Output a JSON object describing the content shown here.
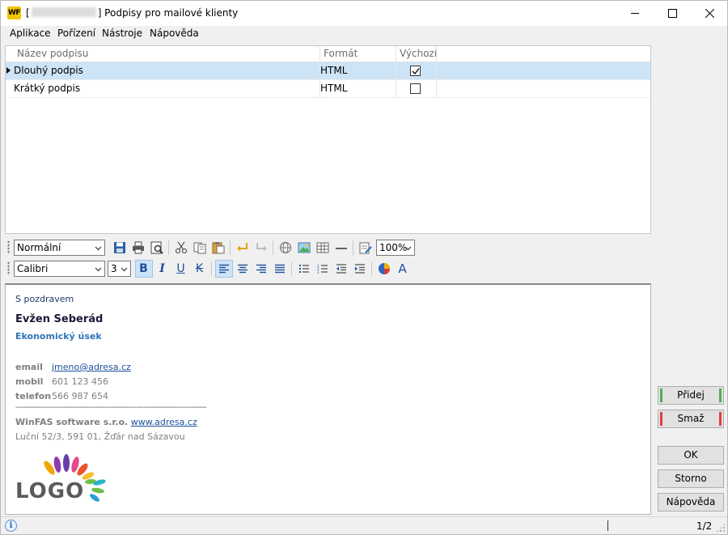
{
  "window": {
    "title_prefix": "[",
    "title_suffix": "] Podpisy pro mailové klienty",
    "minimize_label": "",
    "close_label": ""
  },
  "menu": [
    "Aplikace",
    "Pořízení",
    "Nástroje",
    "Nápověda"
  ],
  "grid": {
    "columns": [
      "Název podpisu",
      "Formát",
      "Výchozí"
    ],
    "rows": [
      {
        "name": "Dlouhý podpis",
        "format": "HTML",
        "default": true,
        "selected": true
      },
      {
        "name": "Krátký podpis",
        "format": "HTML",
        "default": false,
        "selected": false
      }
    ]
  },
  "toolbar1": {
    "style_value": "Normální",
    "zoom_value": "100%",
    "icons": [
      "save-icon",
      "print-icon",
      "print-preview-icon",
      "cut-icon",
      "copy-icon",
      "paste-icon",
      "undo-icon",
      "redo-icon",
      "hyperlink-icon",
      "image-icon",
      "table-icon",
      "horizontal-line-icon",
      "edit-html-icon"
    ]
  },
  "toolbar2": {
    "font_value": "Calibri",
    "size_value": "3",
    "bold": "B",
    "italic": "I",
    "underline": "U",
    "strike": "K",
    "font_color": "A"
  },
  "signature": {
    "greeting": "S pozdravem",
    "name": "Evžen Seberád",
    "department": "Ekonomický úsek",
    "email_label": "email",
    "email_value": "jmeno@adresa.cz",
    "mobile_label": "mobil",
    "mobile_value": "601 123 456",
    "phone_label": "telefon",
    "phone_value": "566 987 654",
    "separator": "----------------------------------------------------------------------------",
    "company": "WinFAS software s.r.o.",
    "company_web": "www.adresa.cz",
    "address": "Luční 52/3, 591 01, Žďár nad Sázavou",
    "logo_text": "LOGO"
  },
  "buttons": {
    "add": "Přidej",
    "delete": "Smaž",
    "ok": "OK",
    "cancel": "Storno",
    "help": "Nápověda"
  },
  "status": {
    "info_icon": "i",
    "page": "1/2"
  },
  "colors": {
    "selection": "#cde4f7",
    "add_accent": "#4caf50",
    "delete_accent": "#e04040",
    "link": "#1a4f9c",
    "department": "#2e75b6"
  }
}
